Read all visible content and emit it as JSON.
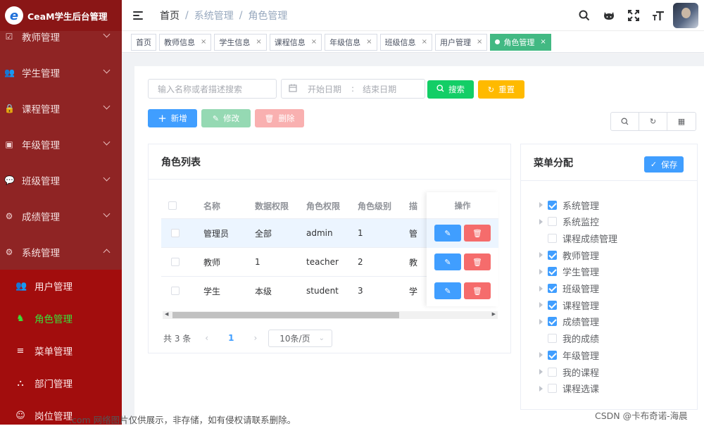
{
  "app": {
    "title": "CeaM学生后台管理",
    "logo_letter": "e"
  },
  "sidebar": {
    "items": [
      {
        "label": "教师管理",
        "icon": "teacher-icon",
        "glyph": "☑"
      },
      {
        "label": "学生管理",
        "icon": "users-icon",
        "glyph": "👥"
      },
      {
        "label": "课程管理",
        "icon": "lock-icon",
        "glyph": "🔒"
      },
      {
        "label": "年级管理",
        "icon": "grade-icon",
        "glyph": "▣"
      },
      {
        "label": "班级管理",
        "icon": "chat-icon",
        "glyph": "💬"
      },
      {
        "label": "成绩管理",
        "icon": "gear-icon",
        "glyph": "⚙"
      },
      {
        "label": "系统管理",
        "icon": "settings-icon",
        "glyph": "⚙"
      }
    ],
    "subitems": [
      {
        "label": "用户管理",
        "icon": "user-group-icon",
        "glyph": "👥"
      },
      {
        "label": "角色管理",
        "icon": "role-icon",
        "glyph": "♞"
      },
      {
        "label": "菜单管理",
        "icon": "list-icon",
        "glyph": "≡"
      },
      {
        "label": "部门管理",
        "icon": "org-icon",
        "glyph": "⛬"
      },
      {
        "label": "岗位管理",
        "icon": "post-icon",
        "glyph": "☺"
      }
    ]
  },
  "breadcrumb": {
    "home": "首页",
    "parent": "系统管理",
    "current": "角色管理",
    "sep": "/"
  },
  "topbar": {
    "icons": [
      "search-icon",
      "github-icon",
      "fullscreen-icon",
      "font-size-icon"
    ],
    "glyphs": [
      "⌕",
      "◉",
      "⛶",
      "T"
    ]
  },
  "tags": [
    {
      "label": "首页",
      "closable": false
    },
    {
      "label": "教师信息",
      "closable": true
    },
    {
      "label": "学生信息",
      "closable": true
    },
    {
      "label": "课程信息",
      "closable": true
    },
    {
      "label": "年级信息",
      "closable": true
    },
    {
      "label": "班级信息",
      "closable": true
    },
    {
      "label": "用户管理",
      "closable": true
    },
    {
      "label": "角色管理",
      "closable": true,
      "active": true
    }
  ],
  "tag_close": "×",
  "search": {
    "placeholder": "输入名称或者描述搜索",
    "date_start": "开始日期",
    "date_sep": ":",
    "date_end": "结束日期",
    "search_label": "搜索",
    "reset_label": "重置"
  },
  "toolbar": {
    "add_label": "新增",
    "edit_label": "修改",
    "delete_label": "删除"
  },
  "colors": {
    "primary": "#409eff",
    "success": "#13ce66",
    "warning": "#ffba00",
    "danger": "#f56c6c",
    "sidebar": "#8f1a1a",
    "active_tag": "#42b983"
  },
  "role_list": {
    "title": "角色列表",
    "columns": [
      "名称",
      "数据权限",
      "角色权限",
      "角色级别",
      "描",
      "操作"
    ],
    "rows": [
      {
        "name": "管理员",
        "data_scope": "全部",
        "permission": "admin",
        "level": "1",
        "desc": "管"
      },
      {
        "name": "教师",
        "data_scope": "1",
        "permission": "teacher",
        "level": "2",
        "desc": "教"
      },
      {
        "name": "学生",
        "data_scope": "本级",
        "permission": "student",
        "level": "3",
        "desc": "学"
      }
    ]
  },
  "pagination": {
    "total": "共 3 条",
    "page": "1",
    "page_size": "10条/页"
  },
  "menu_assign": {
    "title": "菜单分配",
    "save_label": "保存",
    "items": [
      {
        "label": "系统管理",
        "checked": true,
        "expandable": true
      },
      {
        "label": "系统监控",
        "checked": false,
        "expandable": true
      },
      {
        "label": "课程成绩管理",
        "checked": false,
        "expandable": false
      },
      {
        "label": "教师管理",
        "checked": true,
        "expandable": true
      },
      {
        "label": "学生管理",
        "checked": true,
        "expandable": true
      },
      {
        "label": "班级管理",
        "checked": true,
        "expandable": true
      },
      {
        "label": "课程管理",
        "checked": true,
        "expandable": true
      },
      {
        "label": "成绩管理",
        "checked": true,
        "expandable": true
      },
      {
        "label": "我的成绩",
        "checked": false,
        "expandable": false
      },
      {
        "label": "年级管理",
        "checked": true,
        "expandable": true
      },
      {
        "label": "我的课程",
        "checked": false,
        "expandable": true
      },
      {
        "label": "课程选课",
        "checked": false,
        "expandable": true
      }
    ]
  },
  "watermark": {
    "left": ".com 网络图片仅供展示，非存储，如有侵权请联系删除。",
    "right": "CSDN @卡布奇诺-海晨"
  }
}
